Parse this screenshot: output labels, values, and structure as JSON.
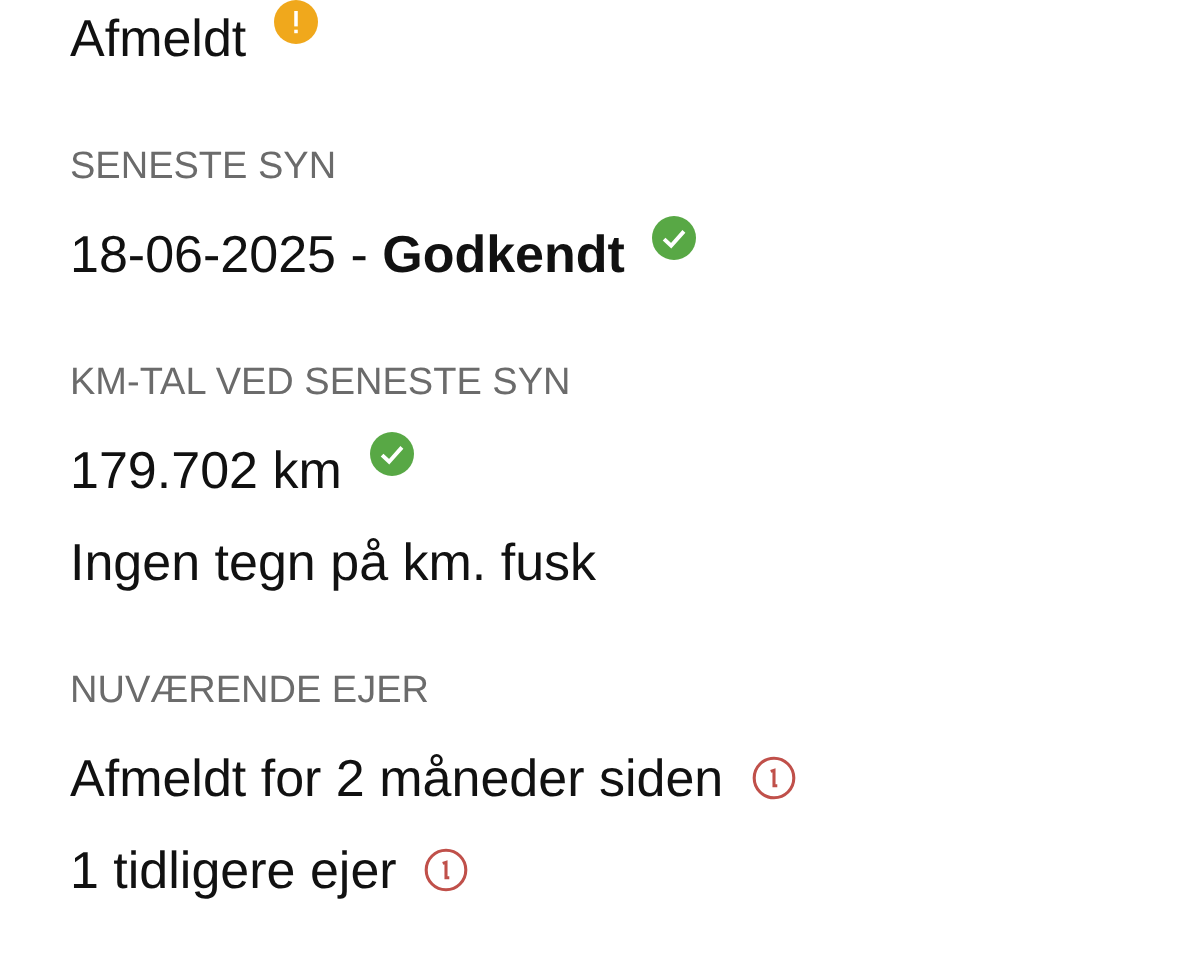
{
  "sections": [
    {
      "lines": [
        {
          "text": "Afmeldt",
          "kind": "warning"
        }
      ]
    },
    {
      "label": "SENESTE SYN",
      "lines": [
        {
          "text": "18-06-2025 - **Godkendt**",
          "kind": "ok"
        }
      ]
    },
    {
      "label": "KM-TAL VED SENESTE SYN",
      "lines": [
        {
          "text": "179.702 km",
          "kind": "ok"
        },
        {
          "text": "Ingen tegn på km. fusk",
          "kind": "plain"
        }
      ]
    },
    {
      "label": "NUVÆRENDE EJER",
      "lines": [
        {
          "text": "Afmeldt for 2 måneder siden",
          "kind": "info"
        },
        {
          "text": "1 tidligere ejer",
          "kind": "info"
        }
      ]
    }
  ]
}
